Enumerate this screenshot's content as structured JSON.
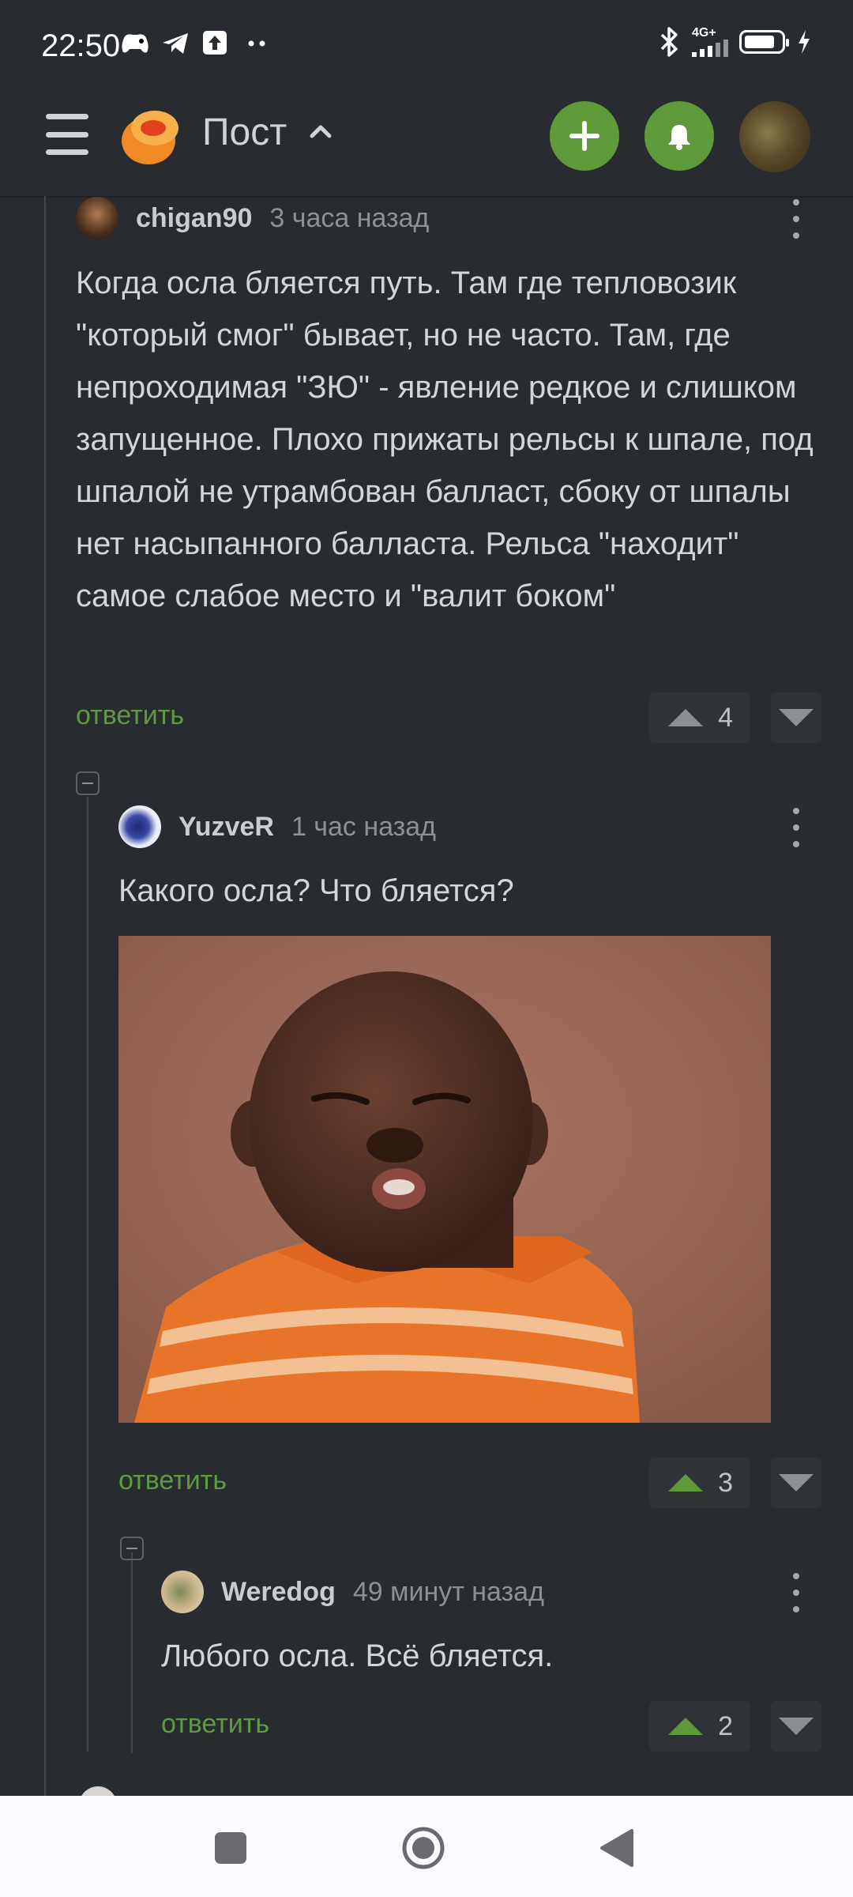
{
  "status_bar": {
    "time": "22:50",
    "network": "4G+",
    "icons": [
      "game-controller-icon",
      "telegram-icon",
      "upload-icon",
      "dots-icon",
      "bluetooth-icon",
      "signal-icon",
      "battery-icon",
      "charging-icon"
    ],
    "battery_level_percent": 85
  },
  "header": {
    "title": "Пост",
    "add_button_icon": "plus-icon",
    "notifications_icon": "bell-icon",
    "accent_color": "#5e9a3a"
  },
  "comments": [
    {
      "user": "chigan90",
      "time": "3 часа назад",
      "text": "Когда осла бляется путь. Там где тепловозик \"который смог\" бывает, но не часто. Там, где непроходимая \"ЗЮ\" - явление редкое и слишком запущенное. Плохо прижаты рельсы к шпале, под шпалой не утрамбован балласт, сбоку от шпалы нет насыпанного балласта. Рельса \"находит\" самое слабое место и \"валит боком\"",
      "reply": "ответить",
      "rating": "4",
      "upvoted": false
    },
    {
      "user": "YuzveR",
      "time": "1 час назад",
      "text": "Какого осла? Что бляется?",
      "image": "meme-photo",
      "reply": "ответить",
      "rating": "3",
      "upvoted": true
    },
    {
      "user": "Weredog",
      "time": "49 минут назад",
      "text": "Любого осла. Всё бляется.",
      "reply": "ответить",
      "rating": "2",
      "upvoted": true
    }
  ],
  "nav_bar": {
    "buttons": [
      "recents-square-icon",
      "home-circle-icon",
      "back-triangle-icon"
    ]
  }
}
